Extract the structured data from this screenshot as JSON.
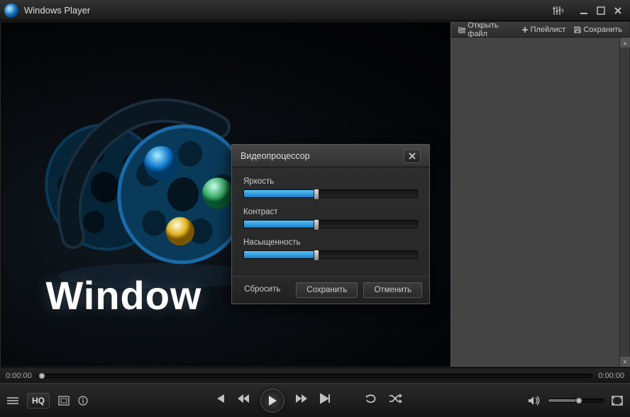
{
  "app": {
    "title": "Windows Player"
  },
  "brand": {
    "text": "Window"
  },
  "playlist": {
    "open": "Открыть файл",
    "playlist": "Плейлист",
    "save": "Сохранить"
  },
  "dialog": {
    "title": "Видеопроцессор",
    "sliders": [
      {
        "label": "Яркость",
        "value": 42
      },
      {
        "label": "Контраст",
        "value": 42
      },
      {
        "label": "Насыщенность",
        "value": 42
      }
    ],
    "reset": "Сбросить",
    "saveBtn": "Сохранить",
    "cancel": "Отменить"
  },
  "seek": {
    "elapsed": "0:00:00",
    "total": "0:00:00",
    "position": 0
  },
  "controls": {
    "hq": "HQ",
    "volume": 55
  }
}
